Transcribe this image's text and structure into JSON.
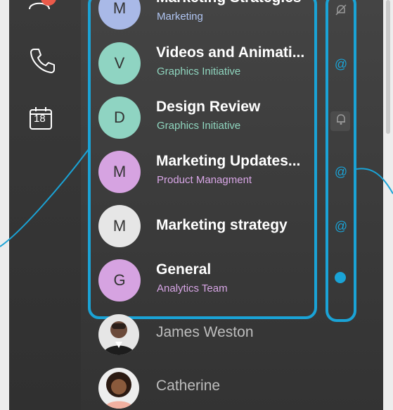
{
  "sidebar": {
    "items": [
      {
        "icon": "people-icon",
        "badge": true
      },
      {
        "icon": "phone-icon"
      },
      {
        "icon": "calendar-icon",
        "day": "18"
      }
    ]
  },
  "conversations": [
    {
      "initial": "M",
      "title": "Marketing Strategies",
      "subtitle": "Marketing",
      "avatar_color": "#a9b9e7",
      "subtitle_color": "#b0c5f2"
    },
    {
      "initial": "V",
      "title": "Videos and Animati...",
      "subtitle": "Graphics Initiative",
      "avatar_color": "#8fd4c2",
      "subtitle_color": "#8fd6bf"
    },
    {
      "initial": "D",
      "title": "Design Review",
      "subtitle": "Graphics Initiative",
      "avatar_color": "#8fd4c2",
      "subtitle_color": "#8fd6bf"
    },
    {
      "initial": "M",
      "title": "Marketing Updates...",
      "subtitle": "Product Managment",
      "avatar_color": "#d6a3e1",
      "subtitle_color": "#d8a6e6"
    },
    {
      "initial": "M",
      "title": "Marketing strategy",
      "subtitle": "",
      "avatar_color": "#e6e6e6",
      "subtitle_color": "#cccccc"
    },
    {
      "initial": "G",
      "title": "General",
      "subtitle": "Analytics Team",
      "avatar_color": "#d6a3e1",
      "subtitle_color": "#d8a6e6"
    }
  ],
  "status_icons": [
    {
      "icon": "bell-off-icon"
    },
    {
      "icon": "at-icon",
      "symbol": "@"
    },
    {
      "icon": "bell-icon"
    },
    {
      "icon": "at-icon",
      "symbol": "@"
    },
    {
      "icon": "at-icon",
      "symbol": "@"
    },
    {
      "icon": "unread-dot-icon"
    }
  ],
  "people": [
    {
      "name": "James Weston"
    },
    {
      "name": "Catherine"
    }
  ],
  "colors": {
    "highlight": "#1aa3d6",
    "badge": "#ea5a4a"
  }
}
